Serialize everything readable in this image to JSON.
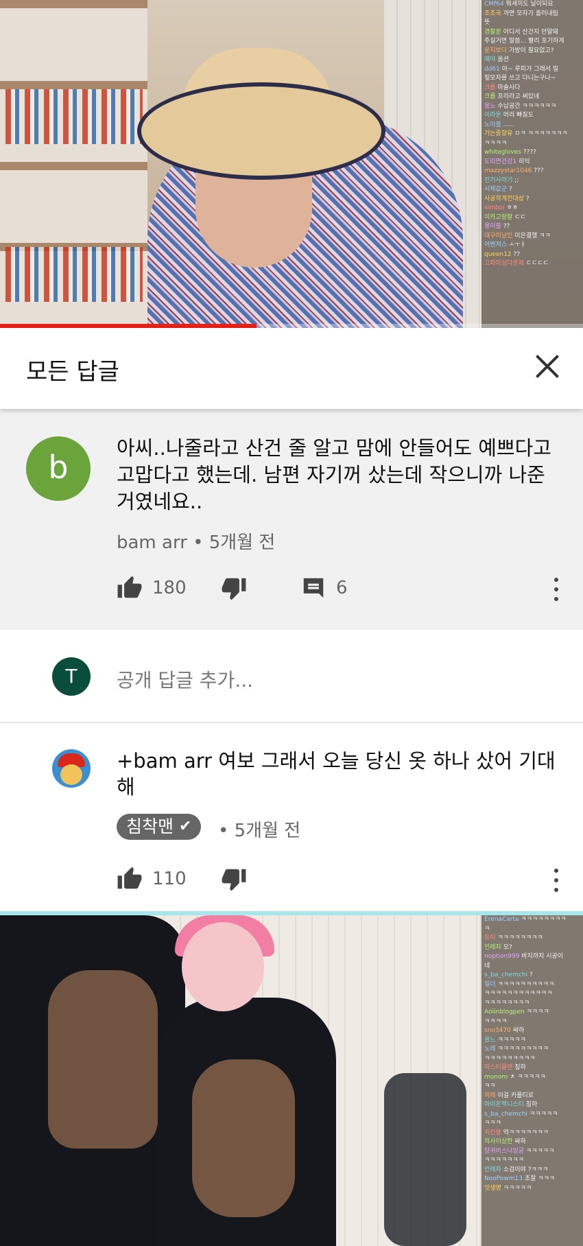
{
  "video_top": {
    "progress": 0.44,
    "chat": [
      {
        "user": "CMf64",
        "text": "뭐세끼도 날이되요"
      },
      {
        "user": "조조곡",
        "text": "까면 모자가 흘러내림"
      },
      {
        "user": "",
        "text": "뜻"
      },
      {
        "user": "경찰분",
        "text": "어디서 산건지 안알돼"
      },
      {
        "user": "",
        "text": "주실거면 말씀... 빨리 포기하게"
      },
      {
        "user": "윤지보다",
        "text": "가방이 필요없고?"
      },
      {
        "user": "예야",
        "text": "옵션"
      },
      {
        "user": "dd61",
        "text": "아~ 루피가 그래서 밀"
      },
      {
        "user": "",
        "text": "짚모자를 쓰고 다니는구나~"
      },
      {
        "user": "크롭",
        "text": "마술사다"
      },
      {
        "user": "크롭",
        "text": "프리라고 써있네"
      },
      {
        "user": "용노",
        "text": "수납공간 ㅋㅋㅋㅋㅋㅋ"
      },
      {
        "user": "",
        "text": ""
      },
      {
        "user": "이라운",
        "text": "머리 빠질도"
      },
      {
        "user": "노이블",
        "text": "......"
      },
      {
        "user": "가는중항유",
        "text": "ㅁㅋ ㅋㅋㅋㅋㅋㅋㅋ"
      },
      {
        "user": "",
        "text": "ㅋㅋㅋㅋ"
      },
      {
        "user": "whitegloves",
        "text": "????"
      },
      {
        "user": "도리면건강1",
        "text": "히익"
      },
      {
        "user": "mazzystar1046",
        "text": "???"
      },
      {
        "user": "진기사라기",
        "text": ";;"
      },
      {
        "user": "시체값군",
        "text": "?"
      },
      {
        "user": "사공작계전대상",
        "text": "?"
      },
      {
        "user": "simboi",
        "text": "ㅎㅎ"
      },
      {
        "user": "이카고량잘",
        "text": "ㄷㄷ"
      },
      {
        "user": "용이블",
        "text": "??"
      },
      {
        "user": "대구미남인",
        "text": "이은결행 ㅋㅋ"
      },
      {
        "user": "",
        "text": ""
      },
      {
        "user": "어벤져스",
        "text": "ㅗㅜㅑ"
      },
      {
        "user": "queen12",
        "text": "??"
      },
      {
        "user": "고파마심다운제",
        "text": "ㄷㄷㄷㄷ"
      }
    ]
  },
  "header": {
    "title": "모든 답글"
  },
  "parent_comment": {
    "avatar_letter": "b",
    "text": "아씨..나줄라고 산건 줄 알고 맘에 안들어도 예쁘다고 고맙다고 했는데. 남편 자기꺼 샀는데 작으니까 나준거였네요..",
    "author": "bam arr",
    "time": "5개월 전",
    "likes": "180",
    "replies": "6"
  },
  "reply_input": {
    "avatar_letter": "T",
    "placeholder": "공개 답글 추가..."
  },
  "reply_comment": {
    "text": "+bam arr 여보 그래서 오늘 당신 옷 하나 샀어 기대해",
    "author": "침착맨",
    "time": "5개월 전",
    "likes": "110"
  },
  "video_bottom": {
    "chat": [
      {
        "user": "ErenaCarta",
        "text": "ㅋㅋㅋㅋㅋㅋㅋㅋ"
      },
      {
        "user": "",
        "text": "ㅋ"
      },
      {
        "user": "트이",
        "text": "ㅋㅋㅋㅋㅋㅋㅋㅋ"
      },
      {
        "user": "언레자",
        "text": "오?"
      },
      {
        "user": "noption999",
        "text": "바지까지 시공이"
      },
      {
        "user": "",
        "text": "네"
      },
      {
        "user": "s_ba_chemchi",
        "text": "?"
      },
      {
        "user": "일더",
        "text": "ㅋㅋㅋㅋㅋㅋㅋㅋㅋㅋ"
      },
      {
        "user": "",
        "text": "ㅋㅋㅋㅋㅋㅋㅋㅋㅋㅋㅋㅋ"
      },
      {
        "user": "",
        "text": "ㅋㅋㅋㅋㅋㅋㅋㅋ"
      },
      {
        "user": "Aoiinblogpen",
        "text": "ㅋㅋㅋㅋ"
      },
      {
        "user": "",
        "text": "ㅋㅋㅋㅋ"
      },
      {
        "user": "sno3470",
        "text": "싸하"
      },
      {
        "user": "룰느",
        "text": "ㅋㅋㅋㅋㅋ"
      },
      {
        "user": "노레",
        "text": "ㅋㅋㅋㅋㅋㅋㅋㅋㅋ"
      },
      {
        "user": "",
        "text": "ㅋㅋㅋㅋㅋㅋㅋㅋㅋ"
      },
      {
        "user": "마스터클랜",
        "text": "칭하"
      },
      {
        "user": "monom",
        "text": "ㅊ ㅋㅋㅋㅋㅋ"
      },
      {
        "user": "",
        "text": "ㅋㅋ"
      },
      {
        "user": "히레",
        "text": "이걸 커플티로"
      },
      {
        "user": "마이온잭니스티",
        "text": "칭하"
      },
      {
        "user": "s_ba_chemchi",
        "text": "ㅋㅋㅋㅋㅋ"
      },
      {
        "user": "",
        "text": "ㅋㅋㅋ"
      },
      {
        "user": "치킨용",
        "text": "억ㅋㅋㅋㅋㅋㅋㅋ"
      },
      {
        "user": "의사이상한",
        "text": "싸하"
      },
      {
        "user": "탕귀비스나잉궁",
        "text": "ㅋㅋㅋㅋㅋ"
      },
      {
        "user": "",
        "text": "ㅋㅋㅋㅋㅋㅋㅋ"
      },
      {
        "user": "언레자",
        "text": "소검이야 ?ㅋㅋㅋ"
      },
      {
        "user": "NooPowm13",
        "text": "초잘 ㅋㅋㅋ"
      },
      {
        "user": "잇생명",
        "text": "ㅋㅋㅋㅋㅋ"
      }
    ]
  },
  "colors": {
    "avatar_b": "#6aa43a",
    "avatar_t": "#0a4d3c",
    "progress": "#e62117",
    "comment_bg": "#f1f1f1",
    "chip_bg": "#666666"
  }
}
